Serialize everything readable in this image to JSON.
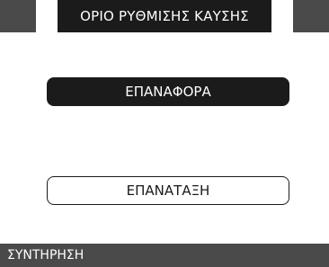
{
  "header": {
    "title": "ΟΡΙΟ ΡΥΘΜΙΣΗΣ ΚΑΥΣΗΣ"
  },
  "actions": {
    "reset_label": "ΕΠΑΝΑΦΟΡΑ",
    "retry_label": "ΕΠΑΝΑΤΑΞΗ"
  },
  "footer": {
    "label": "ΣΥΝΤΗΡΗΣΗ"
  },
  "colors": {
    "bar_dark": "#1b1b1b",
    "bar_edge": "#4a4a4a",
    "background": "#ffffff"
  }
}
